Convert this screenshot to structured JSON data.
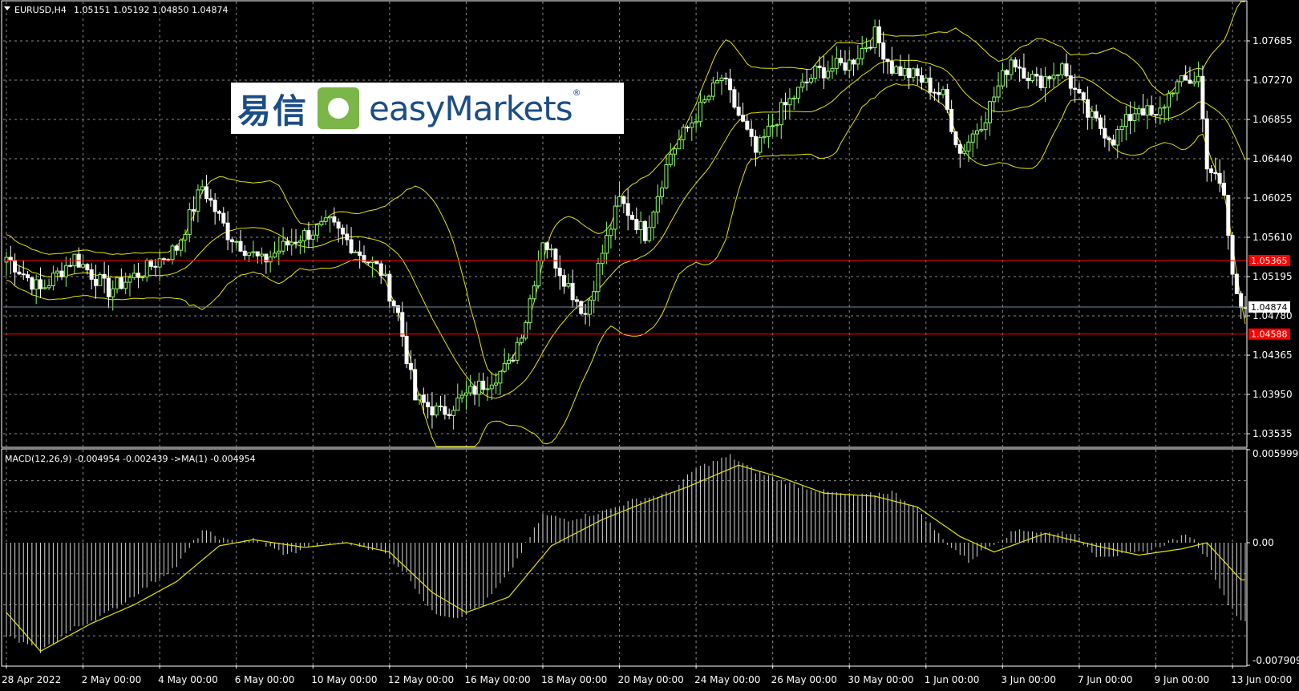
{
  "header": {
    "symbol": "EURUSD,H4",
    "ohlc": "1.05151 1.05192 1.04850 1.04874",
    "macd_label": "MACD(12,26,9) -0.004954 -0.002439  ->MA(1) -0.004954"
  },
  "logo": {
    "cn": "易信",
    "en": "easyMarkets",
    "reg": "®"
  },
  "colors": {
    "background": "#000000",
    "grid": "#8a8a8a",
    "axis": "#ffffff",
    "bull": "#8cff66",
    "bear": "#ffffff",
    "bands": "#e5e500",
    "hline": "#ff0000",
    "current": "#778899"
  },
  "chart_data": [
    {
      "type": "candlestick",
      "title": "EURUSD,H4",
      "y_range": [
        1.034,
        1.081
      ],
      "y_ticks": [
        "1.07685",
        "1.07270",
        "1.06855",
        "1.06440",
        "1.06025",
        "1.05610",
        "1.05195",
        "1.04780",
        "1.04365",
        "1.03950",
        "1.03535"
      ],
      "x_ticks": [
        "28 Apr 2022",
        "2 May 00:00",
        "4 May 00:00",
        "6 May 00:00",
        "10 May 00:00",
        "12 May 00:00",
        "16 May 00:00",
        "18 May 00:00",
        "20 May 00:00",
        "24 May 00:00",
        "26 May 00:00",
        "30 May 00:00",
        "1 Jun 00:00",
        "3 Jun 00:00",
        "7 Jun 00:00",
        "9 Jun 00:00",
        "13 Jun 00:00"
      ],
      "x_tick_candle_index": [
        0,
        18,
        36,
        54,
        72,
        90,
        108,
        126,
        144,
        162,
        180,
        198,
        216,
        234,
        252,
        270,
        288
      ],
      "horizontal_lines": [
        {
          "value": 1.05365,
          "label": "1.05365",
          "color": "#ff0000"
        },
        {
          "value": 1.04588,
          "label": "1.04588",
          "color": "#ff0000"
        }
      ],
      "current_price": {
        "value": 1.04874,
        "label": "1.04874"
      },
      "key_points": [
        {
          "i": 0,
          "close": 1.054
        },
        {
          "i": 8,
          "close": 1.0505
        },
        {
          "i": 16,
          "close": 1.054
        },
        {
          "i": 24,
          "close": 1.0505
        },
        {
          "i": 32,
          "close": 1.0525
        },
        {
          "i": 40,
          "close": 1.055
        },
        {
          "i": 46,
          "close": 1.0615
        },
        {
          "i": 52,
          "close": 1.0565
        },
        {
          "i": 60,
          "close": 1.0535
        },
        {
          "i": 68,
          "close": 1.056
        },
        {
          "i": 76,
          "close": 1.0575
        },
        {
          "i": 84,
          "close": 1.054
        },
        {
          "i": 88,
          "close": 1.0525
        },
        {
          "i": 92,
          "close": 1.048
        },
        {
          "i": 96,
          "close": 1.039
        },
        {
          "i": 102,
          "close": 1.0375
        },
        {
          "i": 110,
          "close": 1.04
        },
        {
          "i": 118,
          "close": 1.0425
        },
        {
          "i": 122,
          "close": 1.0475
        },
        {
          "i": 126,
          "close": 1.056
        },
        {
          "i": 132,
          "close": 1.051
        },
        {
          "i": 136,
          "close": 1.048
        },
        {
          "i": 140,
          "close": 1.0545
        },
        {
          "i": 144,
          "close": 1.06
        },
        {
          "i": 150,
          "close": 1.0565
        },
        {
          "i": 156,
          "close": 1.065
        },
        {
          "i": 162,
          "close": 1.069
        },
        {
          "i": 168,
          "close": 1.073
        },
        {
          "i": 176,
          "close": 1.065
        },
        {
          "i": 182,
          "close": 1.0695
        },
        {
          "i": 190,
          "close": 1.0735
        },
        {
          "i": 198,
          "close": 1.0745
        },
        {
          "i": 204,
          "close": 1.0775
        },
        {
          "i": 208,
          "close": 1.074
        },
        {
          "i": 214,
          "close": 1.073
        },
        {
          "i": 220,
          "close": 1.071
        },
        {
          "i": 224,
          "close": 1.065
        },
        {
          "i": 230,
          "close": 1.069
        },
        {
          "i": 236,
          "close": 1.075
        },
        {
          "i": 242,
          "close": 1.0725
        },
        {
          "i": 248,
          "close": 1.074
        },
        {
          "i": 254,
          "close": 1.069
        },
        {
          "i": 260,
          "close": 1.0665
        },
        {
          "i": 266,
          "close": 1.07
        },
        {
          "i": 270,
          "close": 1.0685
        },
        {
          "i": 274,
          "close": 1.072
        },
        {
          "i": 280,
          "close": 1.073
        },
        {
          "i": 282,
          "close": 1.064
        },
        {
          "i": 286,
          "close": 1.0605
        },
        {
          "i": 288,
          "close": 1.052
        },
        {
          "i": 290,
          "close": 1.0487
        }
      ]
    },
    {
      "type": "macd",
      "title": "MACD(12,26,9) -0.004954 -0.002439  ->MA(1) -0.004954",
      "y_range": [
        -0.007909,
        0.005999
      ],
      "y_ticks": [
        "0.005999",
        "0.00",
        "-0.007909"
      ],
      "key_points": [
        {
          "i": 0,
          "v": -0.006
        },
        {
          "i": 8,
          "v": -0.007
        },
        {
          "i": 16,
          "v": -0.0055
        },
        {
          "i": 24,
          "v": -0.0045
        },
        {
          "i": 32,
          "v": -0.003
        },
        {
          "i": 40,
          "v": -0.0015
        },
        {
          "i": 46,
          "v": 0.0008
        },
        {
          "i": 52,
          "v": 0.0001
        },
        {
          "i": 58,
          "v": 0.0002
        },
        {
          "i": 66,
          "v": -0.0008
        },
        {
          "i": 72,
          "v": -0.0001
        },
        {
          "i": 80,
          "v": 0.0
        },
        {
          "i": 88,
          "v": -0.0005
        },
        {
          "i": 94,
          "v": -0.002
        },
        {
          "i": 100,
          "v": -0.0045
        },
        {
          "i": 106,
          "v": -0.0048
        },
        {
          "i": 112,
          "v": -0.004
        },
        {
          "i": 118,
          "v": -0.002
        },
        {
          "i": 126,
          "v": 0.0018
        },
        {
          "i": 132,
          "v": 0.0015
        },
        {
          "i": 140,
          "v": 0.002
        },
        {
          "i": 148,
          "v": 0.0028
        },
        {
          "i": 156,
          "v": 0.0032
        },
        {
          "i": 162,
          "v": 0.0048
        },
        {
          "i": 170,
          "v": 0.0056
        },
        {
          "i": 176,
          "v": 0.0046
        },
        {
          "i": 184,
          "v": 0.0038
        },
        {
          "i": 192,
          "v": 0.0033
        },
        {
          "i": 200,
          "v": 0.003
        },
        {
          "i": 208,
          "v": 0.0033
        },
        {
          "i": 214,
          "v": 0.0022
        },
        {
          "i": 220,
          "v": 0.0002
        },
        {
          "i": 226,
          "v": -0.0012
        },
        {
          "i": 232,
          "v": 0.0
        },
        {
          "i": 238,
          "v": 0.0009
        },
        {
          "i": 244,
          "v": 0.0006
        },
        {
          "i": 250,
          "v": 0.0007
        },
        {
          "i": 256,
          "v": -0.0008
        },
        {
          "i": 262,
          "v": -0.0008
        },
        {
          "i": 268,
          "v": -0.0006
        },
        {
          "i": 274,
          "v": 0.0002
        },
        {
          "i": 278,
          "v": 0.0005
        },
        {
          "i": 282,
          "v": -0.001
        },
        {
          "i": 286,
          "v": -0.0035
        },
        {
          "i": 290,
          "v": -0.005
        }
      ],
      "signal_key_points": [
        {
          "i": 0,
          "v": -0.0045
        },
        {
          "i": 8,
          "v": -0.007
        },
        {
          "i": 20,
          "v": -0.0052
        },
        {
          "i": 30,
          "v": -0.004
        },
        {
          "i": 40,
          "v": -0.0025
        },
        {
          "i": 50,
          "v": -0.0002
        },
        {
          "i": 58,
          "v": 0.0002
        },
        {
          "i": 70,
          "v": -0.0003
        },
        {
          "i": 80,
          "v": 0.0
        },
        {
          "i": 90,
          "v": -0.0006
        },
        {
          "i": 100,
          "v": -0.0032
        },
        {
          "i": 108,
          "v": -0.0045
        },
        {
          "i": 118,
          "v": -0.0035
        },
        {
          "i": 128,
          "v": -0.0002
        },
        {
          "i": 140,
          "v": 0.0015
        },
        {
          "i": 150,
          "v": 0.0026
        },
        {
          "i": 160,
          "v": 0.0036
        },
        {
          "i": 172,
          "v": 0.005
        },
        {
          "i": 182,
          "v": 0.0042
        },
        {
          "i": 192,
          "v": 0.0032
        },
        {
          "i": 204,
          "v": 0.003
        },
        {
          "i": 214,
          "v": 0.0023
        },
        {
          "i": 224,
          "v": 0.0004
        },
        {
          "i": 232,
          "v": -0.0006
        },
        {
          "i": 244,
          "v": 0.0006
        },
        {
          "i": 256,
          "v": -0.0002
        },
        {
          "i": 266,
          "v": -0.0008
        },
        {
          "i": 276,
          "v": -0.0004
        },
        {
          "i": 282,
          "v": 0.0
        },
        {
          "i": 290,
          "v": -0.0024
        }
      ]
    }
  ]
}
